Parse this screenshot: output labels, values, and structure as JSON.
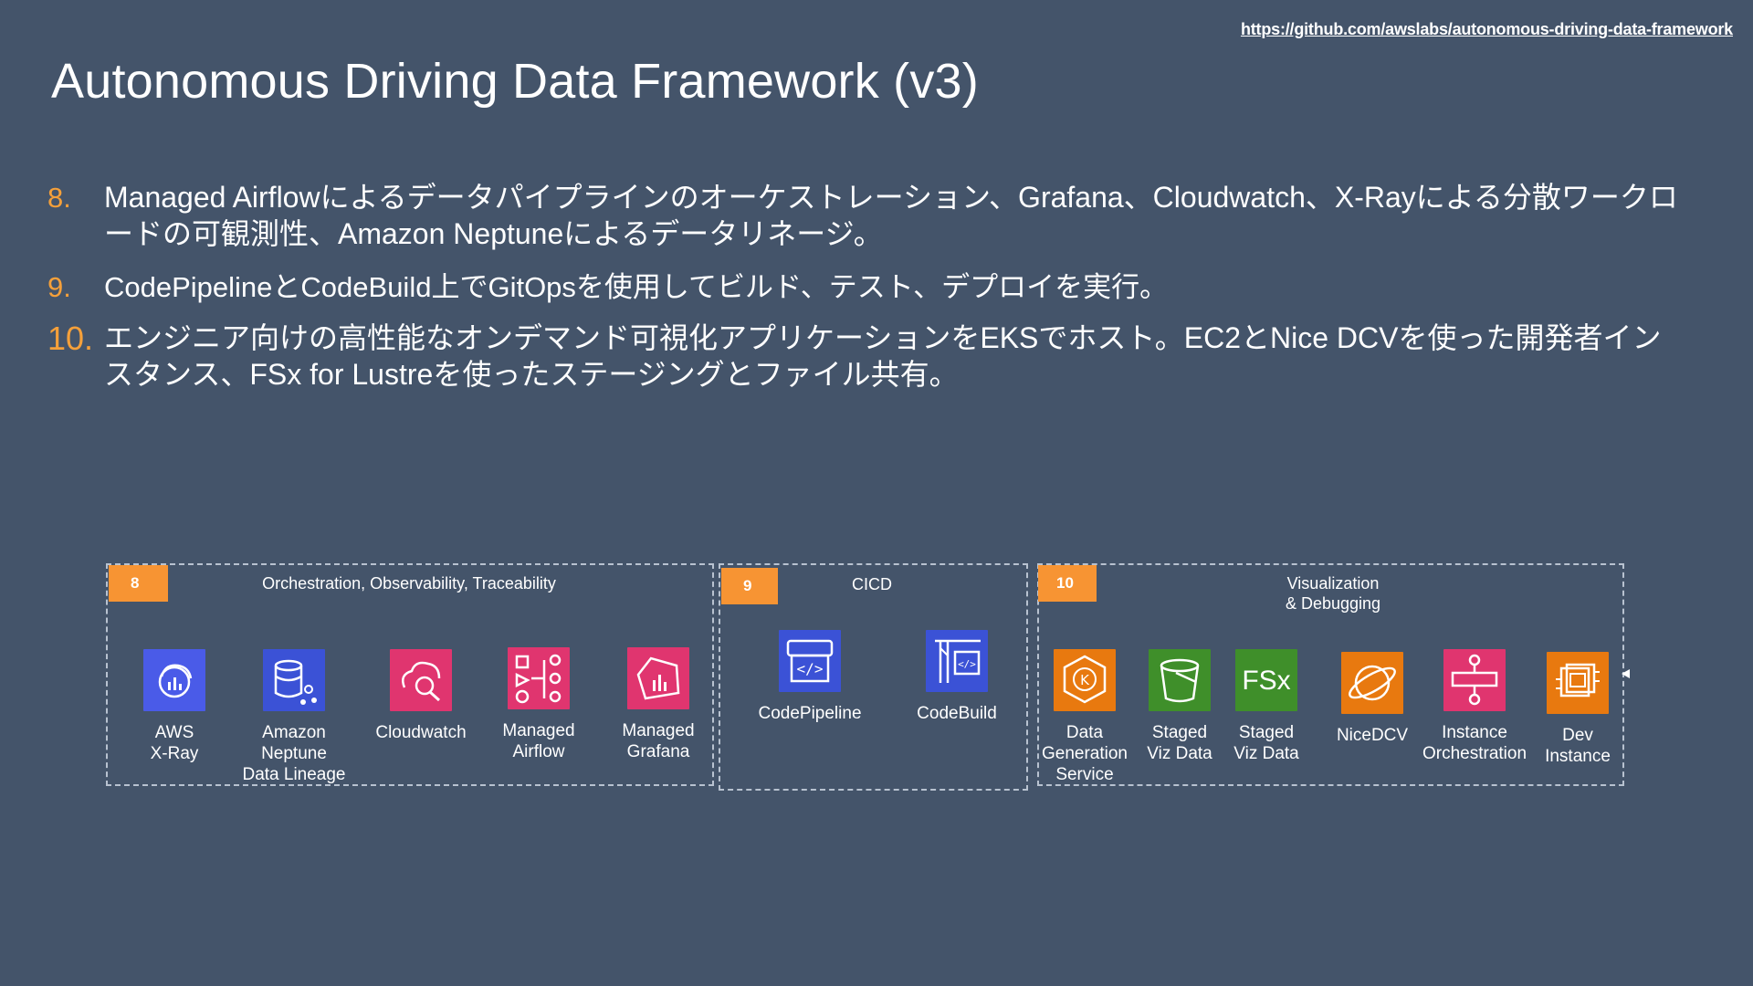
{
  "url": "https://github.com/awslabs/autonomous-driving-data-framework",
  "title": "Autonomous Driving Data Framework (v3)",
  "items": [
    {
      "num": "8.",
      "text": "Managed Airflowによるデータパイプラインのオーケストレーション、Grafana、Cloudwatch、X-Rayによる分散ワークロードの可観測性、Amazon Neptuneによるデータリネージ。"
    },
    {
      "num": "9.",
      "text": "CodePipelineとCodeBuild上でGitOpsを使用してビルド、テスト、デプロイを実行。"
    },
    {
      "num": "10.",
      "text": "エンジニア向けの高性能なオンデマンド可視化アプリケーションをEKSでホスト。EC2とNice DCVを使った開発者インスタンス、FSx for Lustreを使ったステージングとファイル共有。"
    }
  ],
  "groups": [
    {
      "badge": "8",
      "title": "Orchestration, Observability, Traceability",
      "services": [
        {
          "label": "AWS\nX-Ray",
          "icon": "xray-icon",
          "color": "#4a5be8"
        },
        {
          "label": "Amazon Neptune\nData Lineage",
          "icon": "neptune-icon",
          "color": "#3b52d6"
        },
        {
          "label": "Cloudwatch",
          "icon": "cloudwatch-icon",
          "color": "#e0356f"
        },
        {
          "label": "Managed\nAirflow",
          "icon": "airflow-icon",
          "color": "#e0356f"
        },
        {
          "label": "Managed\nGrafana",
          "icon": "grafana-icon",
          "color": "#e0356f"
        }
      ]
    },
    {
      "badge": "9",
      "title": "CICD",
      "services": [
        {
          "label": "CodePipeline",
          "icon": "codepipeline-icon",
          "color": "#3b52d6"
        },
        {
          "label": "CodeBuild",
          "icon": "codebuild-icon",
          "color": "#3b52d6"
        }
      ]
    },
    {
      "badge": "10",
      "title": "Visualization\n& Debugging",
      "services": [
        {
          "label": "Data\nGeneration\nService",
          "icon": "eks-icon",
          "color": "#e8790f"
        },
        {
          "label": "Staged\nViz Data",
          "icon": "s3-icon",
          "color": "#3f8f2a"
        },
        {
          "label": "Staged\nViz Data",
          "icon": "fsx-icon",
          "color": "#3f8f2a"
        },
        {
          "label": "NiceDCV",
          "icon": "nicedcv-icon",
          "color": "#e8790f"
        },
        {
          "label": "Instance\nOrchestration",
          "icon": "stepfunctions-icon",
          "color": "#e0356f"
        },
        {
          "label": "Dev\nInstance",
          "icon": "ec2-icon",
          "color": "#e8790f"
        }
      ]
    }
  ],
  "colors": {
    "background": "#44546a",
    "accent": "#f79433",
    "number": "#f5a03a"
  }
}
